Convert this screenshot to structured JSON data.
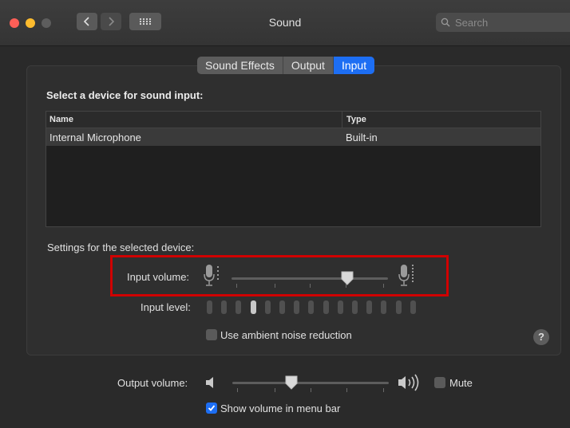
{
  "window": {
    "title": "Sound",
    "search_placeholder": "Search"
  },
  "tabs": [
    {
      "label": "Sound Effects",
      "active": false
    },
    {
      "label": "Output",
      "active": false
    },
    {
      "label": "Input",
      "active": true
    }
  ],
  "input": {
    "select_heading": "Select a device for sound input:",
    "table": {
      "columns": [
        "Name",
        "Type"
      ],
      "rows": [
        {
          "name": "Internal Microphone",
          "type": "Built-in"
        }
      ]
    },
    "settings_heading": "Settings for the selected device:",
    "input_volume_label": "Input volume:",
    "input_volume_value": 0.74,
    "input_level_label": "Input level:",
    "input_level_segments": 15,
    "input_level_active": 4,
    "ambient_label": "Use ambient noise reduction",
    "ambient_checked": false
  },
  "output": {
    "volume_label": "Output volume:",
    "volume_value": 0.38,
    "mute_label": "Mute",
    "mute_checked": false,
    "menubar_label": "Show volume in menu bar",
    "menubar_checked": true
  },
  "help_label": "?",
  "colors": {
    "accent": "#1d6ef3",
    "highlight_box": "#d00000"
  }
}
